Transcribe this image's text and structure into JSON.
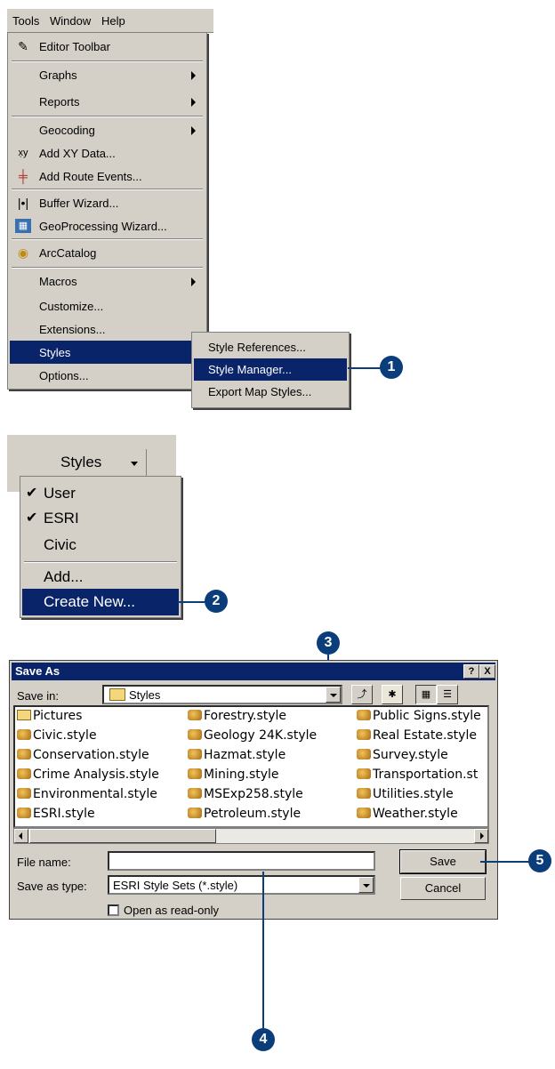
{
  "menubar": {
    "items": [
      "Tools",
      "Window",
      "Help"
    ]
  },
  "tools_menu": {
    "items": [
      {
        "label": "Editor Toolbar",
        "icon": "pencil-icon"
      },
      {
        "label": "Graphs",
        "submenu": true
      },
      {
        "label": "Reports",
        "submenu": true
      },
      {
        "label": "Geocoding",
        "submenu": true
      },
      {
        "label": "Add XY Data...",
        "icon": "xy-icon"
      },
      {
        "label": "Add Route Events...",
        "icon": "route-icon"
      },
      {
        "label": "Buffer Wizard...",
        "icon": "buffer-icon"
      },
      {
        "label": "GeoProcessing Wizard...",
        "icon": "geoprocessing-icon"
      },
      {
        "label": "ArcCatalog",
        "icon": "arccatalog-icon"
      },
      {
        "label": "Macros",
        "submenu": true
      },
      {
        "label": "Customize..."
      },
      {
        "label": "Extensions..."
      },
      {
        "label": "Styles",
        "submenu": true,
        "selected": true
      },
      {
        "label": "Options..."
      }
    ]
  },
  "styles_submenu": {
    "items": [
      "Style References...",
      "Style Manager...",
      "Export Map Styles..."
    ],
    "selected": "Style Manager..."
  },
  "styles_toolbar": {
    "button_label": "Styles"
  },
  "styles_dropdown": {
    "items": [
      {
        "label": "User",
        "checked": true
      },
      {
        "label": "ESRI",
        "checked": true
      },
      {
        "label": "Civic",
        "checked": false
      },
      {
        "label": "Add...",
        "checked": false
      },
      {
        "label": "Create New...",
        "checked": false,
        "selected": true
      }
    ]
  },
  "save_dialog": {
    "title": "Save As",
    "help_btn": "?",
    "close_btn": "X",
    "save_in_label": "Save in:",
    "save_in_value": "Styles",
    "files": [
      {
        "name": "Pictures",
        "type": "folder"
      },
      {
        "name": "Civic.style",
        "type": "style"
      },
      {
        "name": "Conservation.style",
        "type": "style"
      },
      {
        "name": "Crime Analysis.style",
        "type": "style"
      },
      {
        "name": "Environmental.style",
        "type": "style"
      },
      {
        "name": "ESRI.style",
        "type": "style"
      },
      {
        "name": "Forestry.style",
        "type": "style"
      },
      {
        "name": "Geology 24K.style",
        "type": "style"
      },
      {
        "name": "Hazmat.style",
        "type": "style"
      },
      {
        "name": "Mining.style",
        "type": "style"
      },
      {
        "name": "MSExp258.style",
        "type": "style"
      },
      {
        "name": "Petroleum.style",
        "type": "style"
      },
      {
        "name": "Public Signs.style",
        "type": "style"
      },
      {
        "name": "Real Estate.style",
        "type": "style"
      },
      {
        "name": "Survey.style",
        "type": "style"
      },
      {
        "name": "Transportation.st",
        "type": "style"
      },
      {
        "name": "Utilities.style",
        "type": "style"
      },
      {
        "name": "Weather.style",
        "type": "style"
      }
    ],
    "file_name_label": "File name:",
    "file_name_value": "",
    "save_as_type_label": "Save as type:",
    "save_as_type_value": "ESRI Style Sets (*.style)",
    "readonly_label": "Open as read-only",
    "save_button": "Save",
    "cancel_button": "Cancel"
  },
  "callouts": [
    "1",
    "2",
    "3",
    "4",
    "5"
  ],
  "colors": {
    "selection": "#0a246a",
    "callout": "#0a3d7a",
    "face": "#d4d0c8"
  }
}
